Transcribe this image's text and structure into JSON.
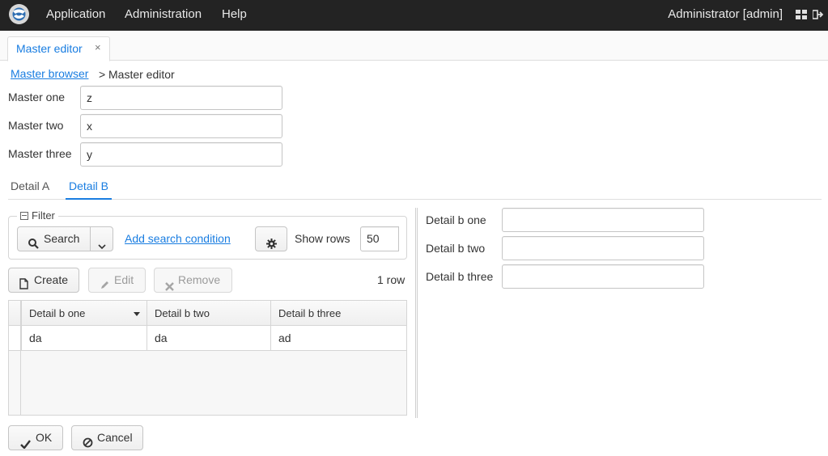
{
  "topbar": {
    "menu": [
      "Application",
      "Administration",
      "Help"
    ],
    "user": "Administrator [admin]",
    "icons": [
      "app-logo-icon",
      "grid-apps-icon",
      "logout-icon"
    ]
  },
  "window_tab": {
    "label": "Master editor",
    "close": "×"
  },
  "breadcrumb": {
    "link": "Master browser",
    "separator": ">",
    "current": "Master editor"
  },
  "master": {
    "fields": [
      {
        "label": "Master one",
        "value": "z"
      },
      {
        "label": "Master two",
        "value": "x"
      },
      {
        "label": "Master three",
        "value": "y"
      }
    ]
  },
  "detail_tabs": {
    "tabs": [
      "Detail A",
      "Detail B"
    ],
    "active": "Detail B"
  },
  "filter": {
    "legend": "Filter",
    "search_label": "Search",
    "add_condition": "Add search condition",
    "show_rows_label": "Show rows",
    "show_rows_value": "50"
  },
  "toolbar": {
    "create": "Create",
    "edit": "Edit",
    "remove": "Remove",
    "row_count": "1 row"
  },
  "table": {
    "columns": [
      "Detail b one",
      "Detail b two",
      "Detail b three"
    ],
    "rows": [
      [
        "da",
        "da",
        "ad"
      ]
    ]
  },
  "detail_form": {
    "fields": [
      {
        "label": "Detail b one",
        "value": ""
      },
      {
        "label": "Detail b two",
        "value": ""
      },
      {
        "label": "Detail b three",
        "value": ""
      }
    ]
  },
  "footer": {
    "ok": "OK",
    "cancel": "Cancel"
  },
  "colors": {
    "accent": "#197de1",
    "topbar": "#232323"
  }
}
